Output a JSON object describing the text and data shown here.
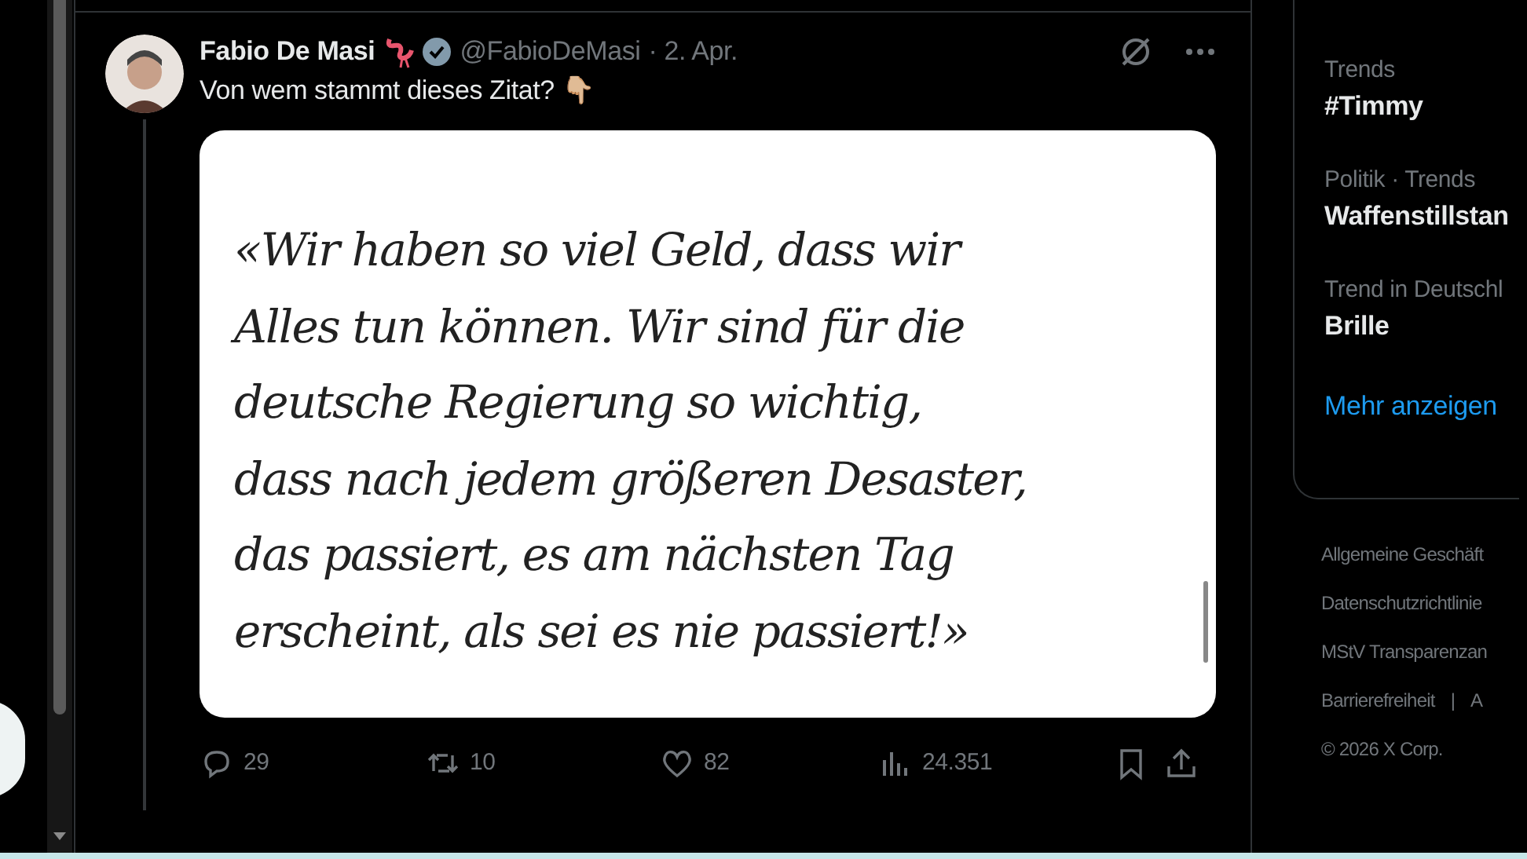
{
  "tweet": {
    "name": "Fabio De Masi",
    "handle": "@FabioDeMasi",
    "date": "· 2. Apr.",
    "text": "Von wem stammt dieses Zitat? 👇🏼",
    "quote": "«Wir haben so viel Geld, dass wir\nAlles tun können. Wir sind für die\ndeutsche Regierung so wichtig,\ndass nach jedem größeren Desaster,\ndas passiert, es am nächsten Tag\nerscheint, als sei es nie passiert!»",
    "actions": [
      {
        "kind": "reply",
        "count": "29"
      },
      {
        "kind": "repost",
        "count": "10"
      },
      {
        "kind": "like",
        "count": "82"
      },
      {
        "kind": "views",
        "count": "24.351"
      },
      {
        "kind": "bookmark"
      },
      {
        "kind": "share"
      }
    ]
  },
  "trends": [
    {
      "context": "Trends",
      "topic": "#Timmy"
    },
    {
      "context": "Politik · Trends",
      "topic": "Waffenstillstan"
    },
    {
      "context": "Trend in Deutschl",
      "topic": "Brille"
    }
  ],
  "show_more": "Mehr anzeigen",
  "footer": [
    "Allgemeine Geschäft",
    "Datenschutzrichtlinie",
    "MStV Transparenzan",
    "Barrierefreiheit",
    "|",
    "A",
    "© 2026 X Corp."
  ]
}
